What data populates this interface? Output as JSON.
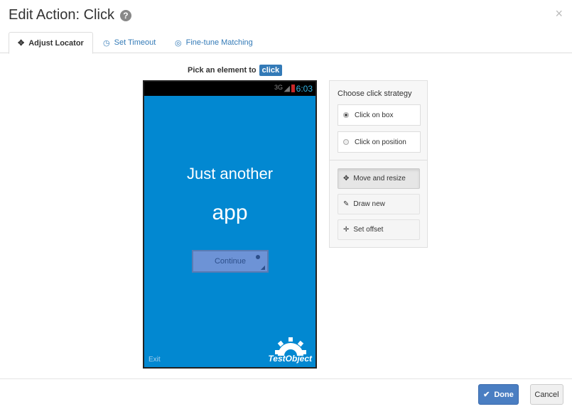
{
  "dialog": {
    "title": "Edit Action: Click",
    "close_glyph": "×"
  },
  "tabs": [
    {
      "label": "Adjust Locator",
      "icon": "move-icon",
      "active": true
    },
    {
      "label": "Set Timeout",
      "icon": "clock-icon",
      "active": false
    },
    {
      "label": "Fine-tune Matching",
      "icon": "target-icon",
      "active": false
    }
  ],
  "instruction": {
    "text": "Pick an element to",
    "action": "click"
  },
  "device": {
    "status_network": "3G",
    "time": "6:03",
    "heading_line1": "Just another",
    "heading_line2": "app",
    "button_label": "Continue",
    "exit_label": "Exit",
    "logo_text": "TestObject"
  },
  "strategy": {
    "title": "Choose click strategy",
    "options": [
      {
        "label": "Click on box",
        "selected": true
      },
      {
        "label": "Click on position",
        "selected": false
      }
    ],
    "tools": [
      {
        "label": "Move and resize",
        "icon": "move-icon",
        "active": true
      },
      {
        "label": "Draw new",
        "icon": "pencil-icon",
        "active": false
      },
      {
        "label": "Set offset",
        "icon": "crosshair-icon",
        "active": false
      }
    ]
  },
  "footer": {
    "done_label": "Done",
    "cancel_label": "Cancel"
  },
  "colors": {
    "phone_background": "#0288d1",
    "primary": "#4a7ec2",
    "link": "#337ab7",
    "status_time": "#33b5e5"
  }
}
